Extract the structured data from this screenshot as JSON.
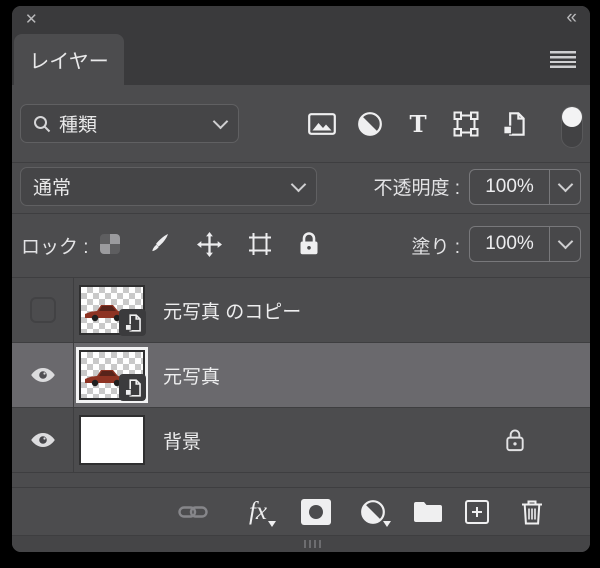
{
  "header": {
    "close_icon": "✕",
    "collapse_icon": "«"
  },
  "tab": {
    "label": "レイヤー"
  },
  "filter_row": {
    "search_label": "種類",
    "type_filter_glyph": "T",
    "filters": [
      "pixel-layers",
      "adjustment-layers",
      "type-layers",
      "shape-layers",
      "smart-objects"
    ],
    "toggle_on": true
  },
  "blend_row": {
    "blend_mode": "通常",
    "opacity_label": "不透明度 :",
    "opacity_value": "100%"
  },
  "lock_row": {
    "label": "ロック :",
    "fill_label": "塗り :",
    "fill_value": "100%"
  },
  "layers": [
    {
      "name": "元写真 のコピー",
      "visible": false,
      "selected": false,
      "smart_object": true,
      "locked": false
    },
    {
      "name": "元写真",
      "visible": true,
      "selected": true,
      "smart_object": true,
      "locked": false
    },
    {
      "name": "背景",
      "visible": true,
      "selected": false,
      "smart_object": false,
      "locked": true
    }
  ],
  "toolbar": {
    "fx_label": "fx",
    "buttons": [
      "link-layers",
      "layer-style",
      "add-layer-mask",
      "new-adjustment-layer",
      "new-group",
      "new-layer",
      "delete-layer"
    ]
  },
  "colors": {
    "panel_bg": "#4c4c4e",
    "header_bg": "#3a3a3c",
    "selected_row": "#6a696d",
    "divider": "#3e3e40",
    "text": "#e9e9ea",
    "icon": "#efeff0",
    "car_red": "#8d3323"
  }
}
